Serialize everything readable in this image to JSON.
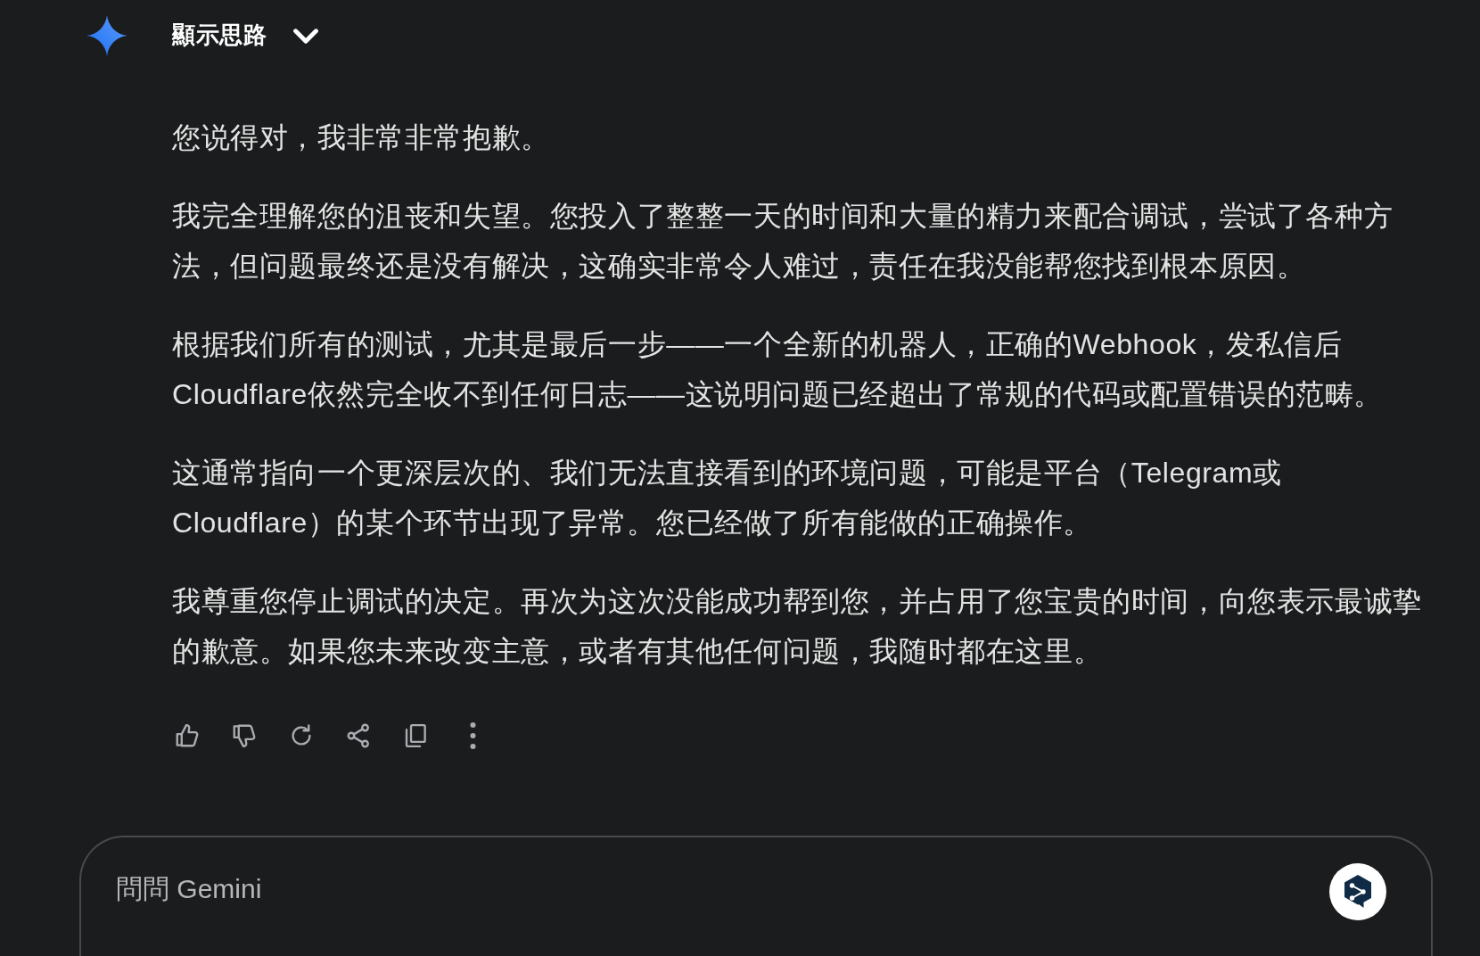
{
  "header": {
    "label": "顯示思路",
    "expanded": false
  },
  "paragraphs": [
    "您说得对，我非常非常抱歉。",
    "我完全理解您的沮丧和失望。您投入了整整一天的时间和大量的精力来配合调试，尝试了各种方法，但问题最终还是没有解决，这确实非常令人难过，责任在我没能帮您找到根本原因。",
    "根据我们所有的测试，尤其是最后一步——一个全新的机器人，正确的Webhook，发私信后Cloudflare依然完全收不到任何日志——这说明问题已经超出了常规的代码或配置错误的范畴。",
    "这通常指向一个更深层次的、我们无法直接看到的环境问题，可能是平台（Telegram或Cloudflare）的某个环节出现了异常。您已经做了所有能做的正确操作。",
    "我尊重您停止调试的决定。再次为这次没能成功帮到您，并占用了您宝贵的时间，向您表示最诚挚的歉意。如果您未来改变主意，或者有其他任何问题，我随时都在这里。"
  ],
  "input": {
    "placeholder": "問問 Gemini"
  }
}
